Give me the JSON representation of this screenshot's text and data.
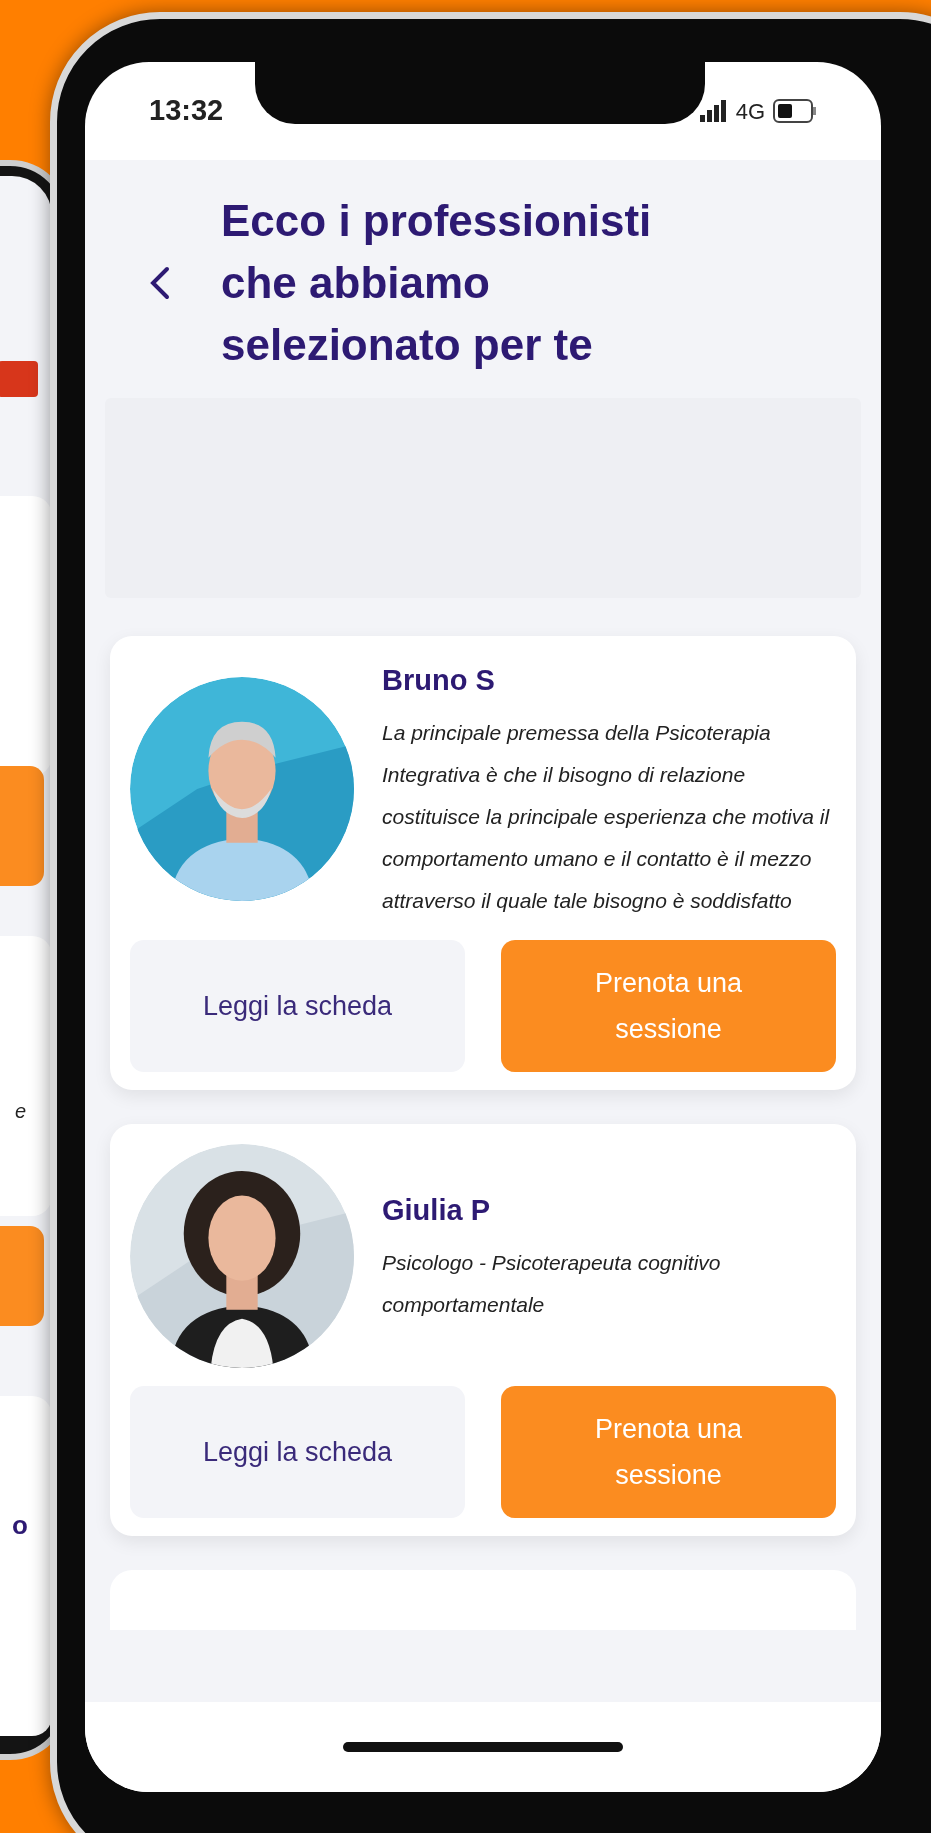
{
  "status_bar": {
    "time": "13:32",
    "network": "4G"
  },
  "header": {
    "title_lines": [
      "Ecco i professionisti",
      "che abbiamo",
      "selezionato per te"
    ]
  },
  "professionals": [
    {
      "name": "Bruno S",
      "description": "La principale premessa della Psicoterapia Integrativa è che il bisogno di relazione costituisce la principale esperienza che motiva il comportamento umano e il contatto è il mezzo attraverso il quale tale bisogno è soddisfatto",
      "details_button": "Leggi la scheda",
      "book_button": "Prenota una sessione"
    },
    {
      "name": "Giulia P",
      "description": "Psicologo - Psicoterapeuta cognitivo comportamentale",
      "details_button": "Leggi la scheda",
      "book_button": "Prenota una sessione"
    }
  ],
  "background_phone": {
    "fragments": [
      "e",
      "o"
    ]
  }
}
